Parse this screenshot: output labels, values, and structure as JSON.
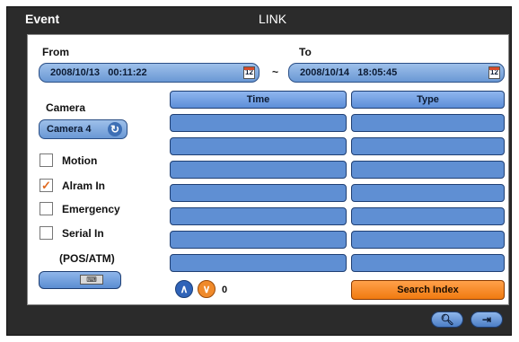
{
  "window": {
    "title": "Event",
    "subtitle": "LINK"
  },
  "from": {
    "label": "From",
    "value": "2008/10/13   00:11:22",
    "cal_day": "12"
  },
  "to": {
    "label": "To",
    "value": "2008/10/14   18:05:45",
    "cal_day": "12"
  },
  "range_separator": "~",
  "camera": {
    "label": "Camera",
    "selected": "Camera 4"
  },
  "filters": [
    {
      "label": "Motion",
      "checked": false
    },
    {
      "label": "Alram In",
      "checked": true
    },
    {
      "label": "Emergency",
      "checked": false
    },
    {
      "label": "Serial In",
      "checked": false
    }
  ],
  "pos_atm": {
    "label": "(POS/ATM)",
    "keyboard_icon": "keyboard-icon"
  },
  "table": {
    "columns": [
      "Time",
      "Type"
    ],
    "rows": [
      [
        "",
        ""
      ],
      [
        "",
        ""
      ],
      [
        "",
        ""
      ],
      [
        "",
        ""
      ],
      [
        "",
        ""
      ],
      [
        "",
        ""
      ],
      [
        "",
        ""
      ]
    ]
  },
  "pager": {
    "count": "0",
    "up_icon": "chevron-up-icon",
    "down_icon": "chevron-down-icon"
  },
  "search_index_label": "Search Index",
  "footer": {
    "search_icon": "search-icon",
    "exit_icon": "exit-icon"
  },
  "colors": {
    "frame": "#2b2b2b",
    "field_blue": "#6a98d4",
    "accent_orange": "#f07a10"
  }
}
